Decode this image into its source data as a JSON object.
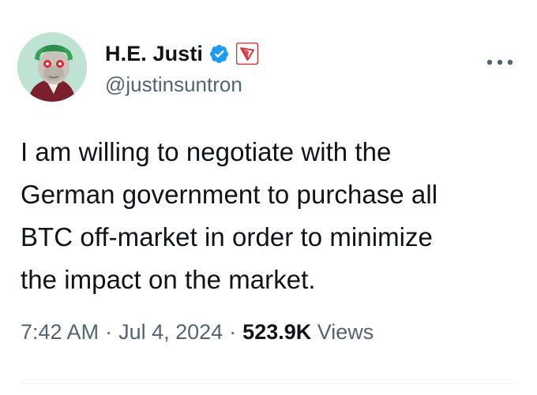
{
  "author": {
    "display_name": "H.E. Justi",
    "handle": "@justinsuntron",
    "verified_icon": "verified-badge-icon",
    "affiliate_icon": "tron-logo-icon"
  },
  "tweet": {
    "text_lines": [
      "I am willing to negotiate with the",
      "German government to purchase all",
      "BTC off-market in order to minimize",
      "the impact on the market."
    ],
    "time": "7:42 AM",
    "separator": "·",
    "date": "Jul 4, 2024",
    "views_count": "523.9K",
    "views_label": "Views"
  },
  "colors": {
    "verified_blue": "#1d9bf0",
    "tron_red": "#e0262f",
    "secondary_text": "#536471",
    "primary_text": "#0f1419"
  }
}
